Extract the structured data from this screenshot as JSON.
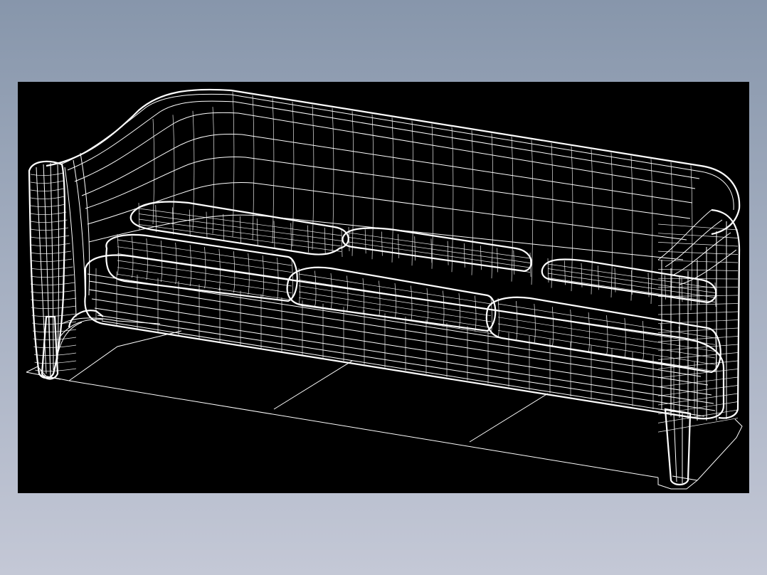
{
  "background": {
    "top": "#8796ab",
    "bottom": "#c4c8d6"
  },
  "viewport": {
    "background": "#000000",
    "line_color": "#ffffff"
  },
  "model": {
    "subject": "three-seat sofa",
    "render_mode": "wireframe"
  }
}
